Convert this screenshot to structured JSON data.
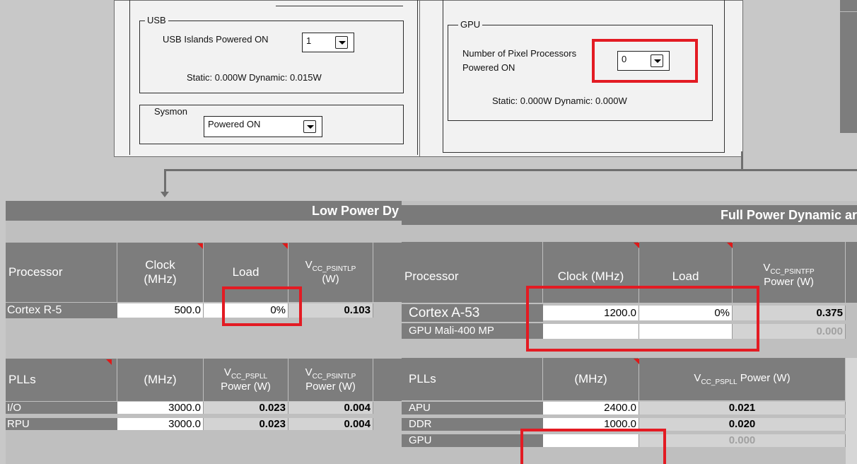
{
  "usb": {
    "group_title": "USB",
    "islands_label": "USB Islands Powered ON",
    "islands_value": "1",
    "static_dynamic": "Static: 0.000W   Dynamic: 0.015W"
  },
  "sysmon": {
    "group_title": "Sysmon",
    "state_value": "Powered ON"
  },
  "gpu": {
    "group_title": "GPU",
    "pixel_label_line1": "Number of Pixel Processors",
    "pixel_label_line2": "Powered ON",
    "pixel_value": "0",
    "static_dynamic": "Static: 0.000W   Dynamic: 0.000W"
  },
  "low_power": {
    "title": "Low Power Dy",
    "processor_header": "Processor",
    "clock_header_line1": "Clock",
    "clock_header_line2": "(MHz)",
    "load_header": "Load",
    "vcc_header_main": "V",
    "vcc_header_sub": "CC_PSINTLP",
    "vcc_header_unit": "(W)",
    "cpu_row": {
      "name": "Cortex R-5",
      "clock": "500.0",
      "load": "0%",
      "power": "0.103"
    },
    "plls_header": "PLLs",
    "plls_mhz_header": "(MHz)",
    "pll_vcc_pspll_main": "V",
    "pll_vcc_pspll_sub": "CC_PSPLL",
    "pll_vcc_pspll_unit": "Power (W)",
    "pll_vcc_psintlp_main": "V",
    "pll_vcc_psintlp_sub": "CC_PSINTLP",
    "pll_vcc_psintlp_unit": "Power (W)",
    "pll_rows": [
      {
        "name": "I/O",
        "mhz": "3000.0",
        "pspll": "0.023",
        "psintlp": "0.004"
      },
      {
        "name": "RPU",
        "mhz": "3000.0",
        "pspll": "0.023",
        "psintlp": "0.004"
      }
    ]
  },
  "full_power": {
    "title": "Full Power Dynamic ar",
    "processor_header": "Processor",
    "clock_header": "Clock (MHz)",
    "load_header": "Load",
    "vcc_header_main": "V",
    "vcc_header_sub": "CC_PSINTFP",
    "vcc_header_unit": "Power (W)",
    "cpu_rows": [
      {
        "name": "Cortex A-53",
        "clock": "1200.0",
        "load": "0%",
        "power": "0.375"
      },
      {
        "name": "GPU  Mali-400 MP",
        "clock": "",
        "load": "",
        "power": "0.000"
      }
    ],
    "plls_header": "PLLs",
    "plls_mhz_header": "(MHz)",
    "pll_vcc_main": "V",
    "pll_vcc_sub": "CC_PSPLL",
    "pll_vcc_unit": " Power (W)",
    "pll_rows": [
      {
        "name": "APU",
        "mhz": "2400.0",
        "power": "0.021"
      },
      {
        "name": "DDR",
        "mhz": "1000.0",
        "power": "0.020"
      },
      {
        "name": "GPU",
        "mhz": "",
        "power": "0.000"
      }
    ]
  },
  "colors": {
    "highlight": "#e31b23",
    "header_gray": "#7d7d7d",
    "title_gray": "#7a7a7a",
    "sheet_gray": "#bfbfbf",
    "panel_light": "#f2f2f2",
    "comment_marker": "#e01919"
  }
}
